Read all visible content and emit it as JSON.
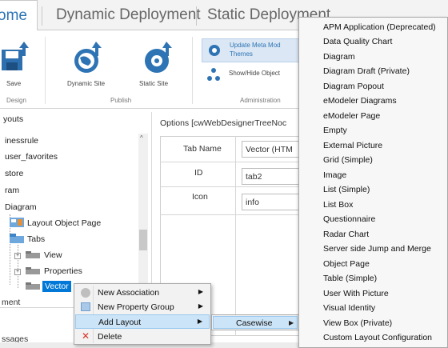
{
  "ribbon_tabs": [
    "ome",
    "Dynamic Deployment",
    "Static Deployment"
  ],
  "ribbon": {
    "save_label": "Save",
    "design_group": "Design",
    "dynamic_site_label": "Dynamic Site",
    "static_site_label": "Static Site",
    "publish_group": "Publish",
    "update_meta_line1": "Update Meta Mod",
    "update_meta_line2": "Themes",
    "show_hide_label": "Show/Hide Object",
    "administration_group": "Administration"
  },
  "tree": {
    "header": "youts",
    "items": [
      "inessrule",
      "user_favorites",
      "store",
      "ram",
      "Diagram",
      "Layout Object Page",
      "Tabs",
      "View",
      "Properties",
      "Vector"
    ],
    "footer_fragment": "ment",
    "messages_fragment": "ssages"
  },
  "options": {
    "title": "Options [cwWebDesignerTreeNoc",
    "rows": [
      {
        "label": "Tab Name",
        "value": "Vector (HTM"
      },
      {
        "label": "ID",
        "value": "tab2"
      },
      {
        "label": "Icon",
        "value": "info"
      }
    ]
  },
  "context_menu": {
    "items": [
      {
        "label": "New Association",
        "has_submenu": true
      },
      {
        "label": "New Property Group",
        "has_submenu": true
      },
      {
        "label": "Add Layout",
        "has_submenu": true
      },
      {
        "label": "Delete",
        "has_submenu": false
      }
    ],
    "submenu_label": "Casewise"
  },
  "layouts_menu": [
    "APM Application (Deprecated)",
    "Data Quality Chart",
    "Diagram",
    "Diagram Draft (Private)",
    "Diagram Popout",
    "eModeler Diagrams",
    "eModeler Page",
    "Empty",
    "External Picture",
    "Grid (Simple)",
    "Image",
    "List (Simple)",
    "List Box",
    "Questionnaire",
    "Radar Chart",
    "Server side Jump and Merge",
    "Object Page",
    "Table (Simple)",
    "User With Picture",
    "Visual Identity",
    "View Box (Private)",
    "Custom Layout Configuration"
  ],
  "colors": {
    "accent": "#2e74b5",
    "selection": "#0078d7",
    "menu_highlight": "#cce4f7"
  }
}
